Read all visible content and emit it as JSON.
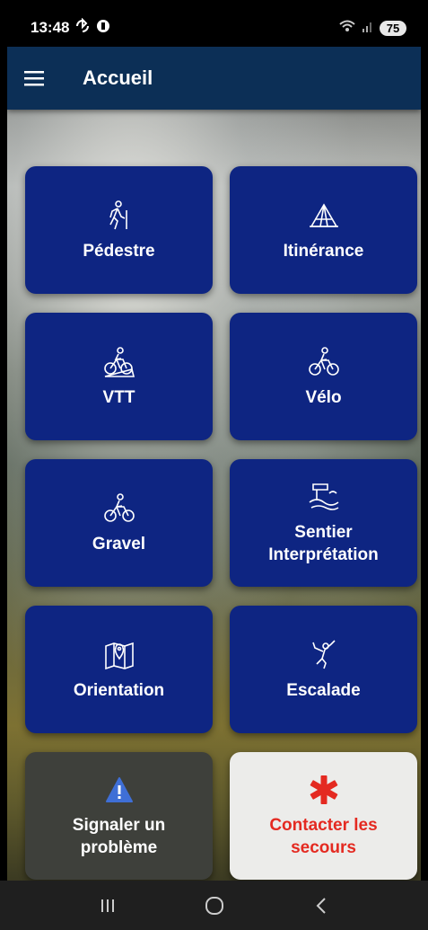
{
  "status": {
    "time": "13:48",
    "battery": "75"
  },
  "app_bar": {
    "title": "Accueil"
  },
  "tiles": [
    {
      "label": "Pédestre",
      "icon": "hiker-icon"
    },
    {
      "label": "Itinérance",
      "icon": "tent-icon"
    },
    {
      "label": "VTT",
      "icon": "mountain-bike-icon"
    },
    {
      "label": "Vélo",
      "icon": "cyclist-icon"
    },
    {
      "label": "Gravel",
      "icon": "gravel-bike-icon"
    },
    {
      "label": "Sentier\nInterprétation",
      "icon": "landscape-sign-icon"
    },
    {
      "label": "Orientation",
      "icon": "map-pin-icon"
    },
    {
      "label": "Escalade",
      "icon": "climber-icon"
    }
  ],
  "actions": {
    "report": {
      "label": "Signaler un\nproblème",
      "icon": "warning-icon"
    },
    "rescue": {
      "label": "Contacter les\nsecours",
      "icon": "asterisk-icon"
    }
  },
  "colors": {
    "app_bar": "#0c2f56",
    "tile": "#0e2582",
    "rescue_text": "#e42a21"
  }
}
